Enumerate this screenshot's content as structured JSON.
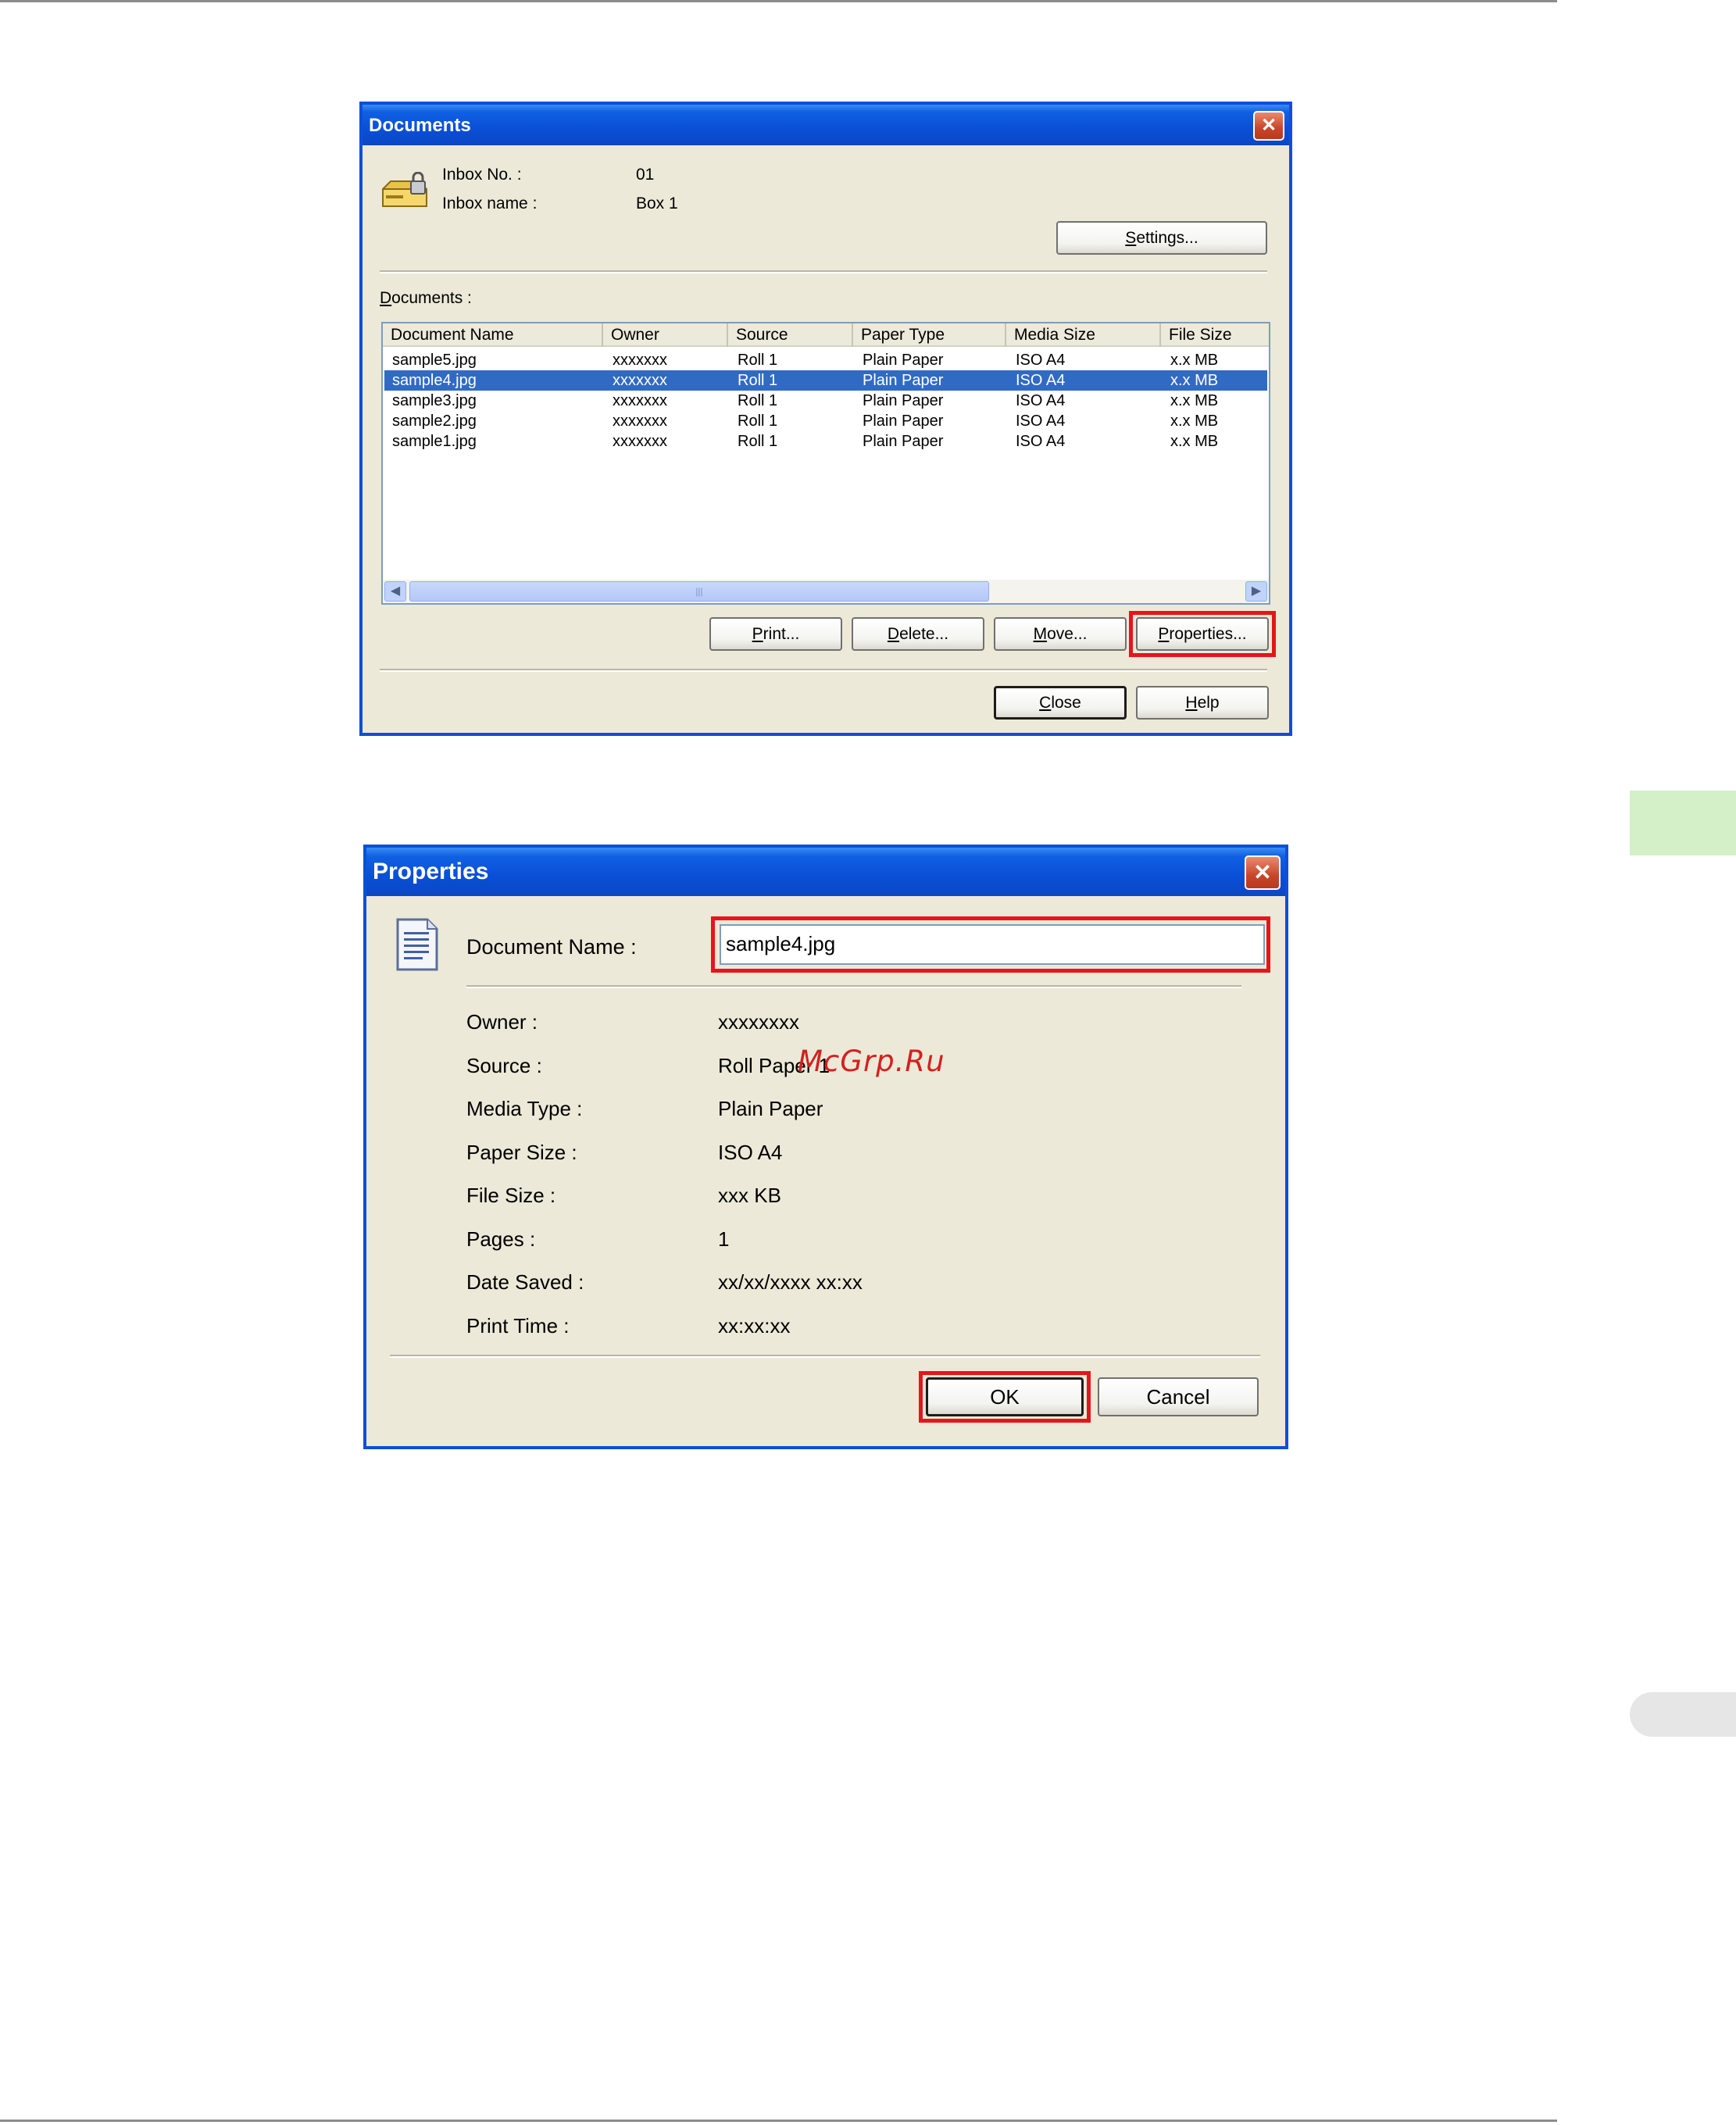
{
  "documents_window": {
    "title": "Documents",
    "close_glyph": "✕",
    "inbox_no_label": "Inbox No. :",
    "inbox_no_value": "01",
    "inbox_name_label": "Inbox name :",
    "inbox_name_value": "Box 1",
    "settings_prefix": "S",
    "settings_rest": "ettings...",
    "documents_label_prefix": "D",
    "documents_label_rest": "ocuments :",
    "columns": [
      "Document Name",
      "Owner",
      "Source",
      "Paper Type",
      "Media Size",
      "File Size"
    ],
    "rows": [
      [
        "sample5.jpg",
        "xxxxxxx",
        "Roll 1",
        "Plain Paper",
        "ISO A4",
        "x.x MB"
      ],
      [
        "sample4.jpg",
        "xxxxxxx",
        "Roll 1",
        "Plain Paper",
        "ISO A4",
        "x.x MB"
      ],
      [
        "sample3.jpg",
        "xxxxxxx",
        "Roll 1",
        "Plain Paper",
        "ISO A4",
        "x.x MB"
      ],
      [
        "sample2.jpg",
        "xxxxxxx",
        "Roll 1",
        "Plain Paper",
        "ISO A4",
        "x.x MB"
      ],
      [
        "sample1.jpg",
        "xxxxxxx",
        "Roll 1",
        "Plain Paper",
        "ISO A4",
        "x.x MB"
      ]
    ],
    "selected_row": 1,
    "scroll_left_glyph": "◀",
    "scroll_right_glyph": "▶",
    "scroll_grip_glyph": "|||",
    "print_prefix": "P",
    "print_rest": "rint...",
    "delete_prefix": "D",
    "delete_rest": "elete...",
    "move_prefix": "M",
    "move_rest": "ove...",
    "properties_prefix": "P",
    "properties_rest": "roperties...",
    "close_prefix": "C",
    "close_rest": "lose",
    "help_prefix": "H",
    "help_rest": "elp"
  },
  "properties_window": {
    "title": "Properties",
    "close_glyph": "✕",
    "document_name_label": "Document Name :",
    "document_name_value": "sample4.jpg",
    "fields": [
      {
        "label": "Owner :",
        "value": "xxxxxxxx"
      },
      {
        "label": "Source :",
        "value": "Roll Paper 1"
      },
      {
        "label": "Media Type :",
        "value": "Plain Paper"
      },
      {
        "label": "Paper Size :",
        "value": "ISO A4"
      },
      {
        "label": "File Size :",
        "value": "xxx KB"
      },
      {
        "label": "Pages :",
        "value": "1"
      },
      {
        "label": "Date Saved :",
        "value": "xx/xx/xxxx xx:xx"
      },
      {
        "label": "Print Time :",
        "value": "xx:xx:xx"
      }
    ],
    "ok_label": "OK",
    "cancel_label": "Cancel"
  },
  "watermark": "McGrp.Ru",
  "colors": {
    "titlebar": "#0a4fd6",
    "dialog_bg": "#ece9d8",
    "selection": "#316ac5",
    "highlight_box": "#e8141b",
    "side_tab": "#d3f0c8"
  }
}
